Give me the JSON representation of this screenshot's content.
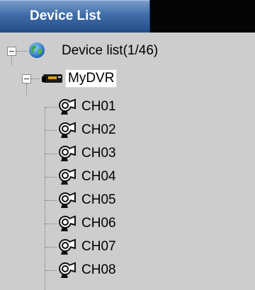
{
  "tab": {
    "label": "Device List"
  },
  "tree": {
    "root": {
      "label": "Device list(1/46)",
      "icon": "globe-icon",
      "expanded": true
    },
    "device": {
      "label": "MyDVR",
      "icon": "dvr-icon",
      "expanded": true,
      "selected": true
    },
    "channels": [
      {
        "label": "CH01",
        "icon": "camera-icon"
      },
      {
        "label": "CH02",
        "icon": "camera-icon"
      },
      {
        "label": "CH03",
        "icon": "camera-icon"
      },
      {
        "label": "CH04",
        "icon": "camera-icon"
      },
      {
        "label": "CH05",
        "icon": "camera-icon"
      },
      {
        "label": "CH06",
        "icon": "camera-icon"
      },
      {
        "label": "CH07",
        "icon": "camera-icon"
      },
      {
        "label": "CH08",
        "icon": "camera-icon"
      }
    ]
  },
  "colors": {
    "tab_blue": "#3f6ca7",
    "tabbar_black": "#050505",
    "panel_gray": "#cdcdcd"
  }
}
